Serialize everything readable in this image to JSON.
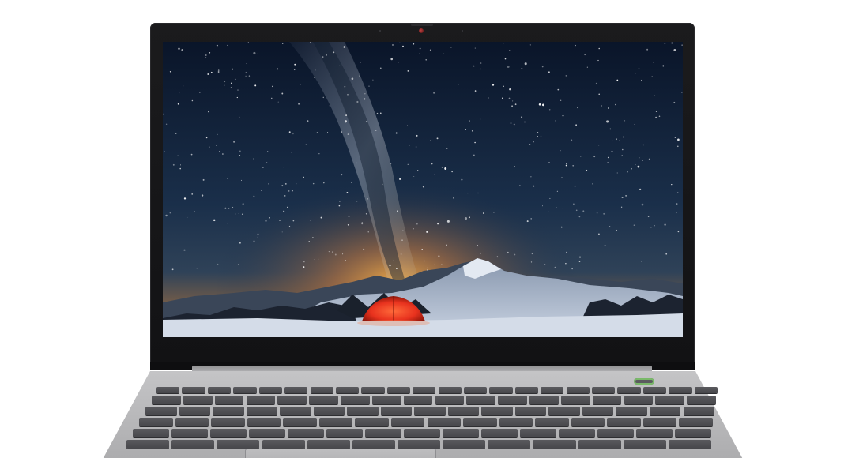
{
  "image": {
    "subject": "laptop",
    "lid_color": "#141416",
    "base_color": "#b8b8ba",
    "key_color": "#4d4d51",
    "power_led_color": "#7ab96a"
  },
  "wallpaper": {
    "sky_top": "#0b1730",
    "sky_mid": "#1c3350",
    "horizon_glow": "#f0a13a",
    "snow": "#cfd8e6",
    "tent": "#e8321e"
  }
}
